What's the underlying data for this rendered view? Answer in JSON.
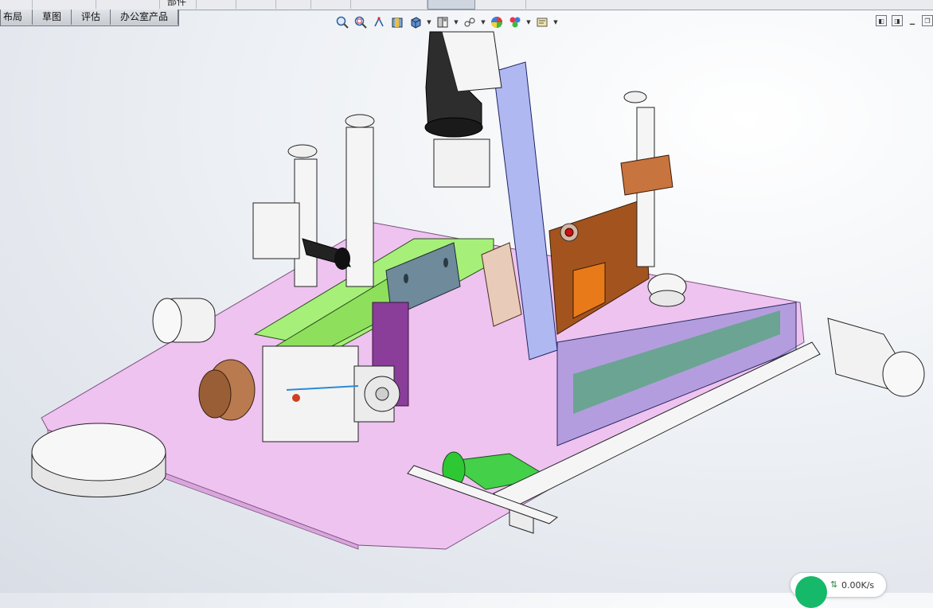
{
  "top_strip": {
    "partial_label": "部件"
  },
  "tabs": [
    {
      "label": "布局"
    },
    {
      "label": "草图"
    },
    {
      "label": "评估"
    },
    {
      "label": "办公室产品"
    }
  ],
  "heads_up_toolbar": {
    "buttons": [
      "zoom-to-fit-icon",
      "zoom-to-area-icon",
      "previous-view-icon",
      "section-view-icon",
      "view-orientation-icon",
      "display-style-icon",
      "hide-show-items-icon",
      "edit-appearance-icon",
      "apply-scene-icon",
      "view-settings-icon"
    ]
  },
  "status": {
    "net_speed": "0.00K/s"
  }
}
